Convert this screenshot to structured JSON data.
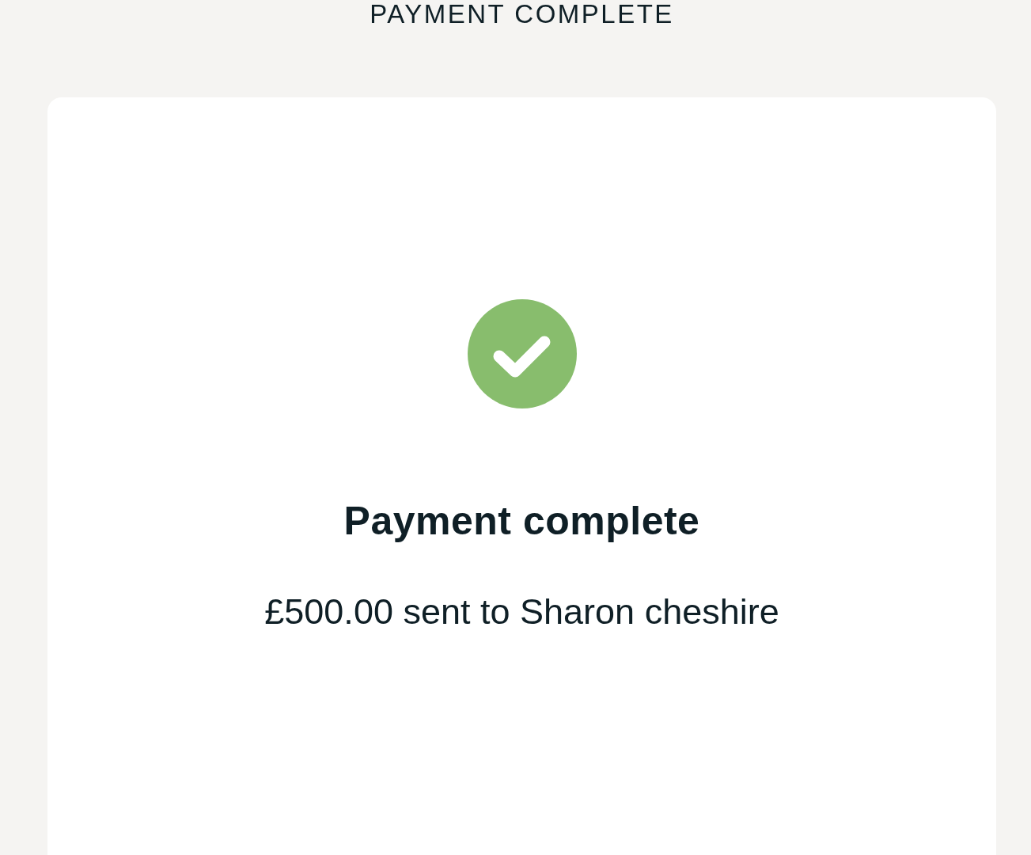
{
  "header": {
    "title": "PAYMENT COMPLETE"
  },
  "card": {
    "heading": "Payment complete",
    "message": "£500.00 sent to Sharon cheshire"
  }
}
